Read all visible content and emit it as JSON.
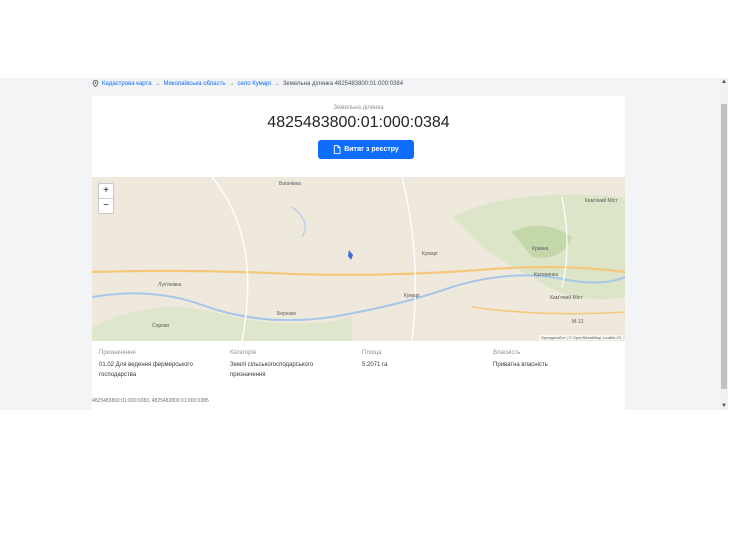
{
  "breadcrumb": {
    "items": [
      "Кадастрова карта",
      "Миколаївська область",
      "село Кумарі"
    ],
    "separator": "→",
    "current": "Земельна ділянка 4825483800:01:000:0384"
  },
  "header": {
    "eyebrow": "Земельна ділянка",
    "parcel_number": "4825483800:01:000:0384",
    "extract_button": "Витяг з реєстру"
  },
  "map": {
    "zoom_in": "+",
    "zoom_out": "−",
    "attribution": "Openдатабот | © OpenStreetMap, Leaflet.JS",
    "places": {
      "bahachivka": "Багачівка",
      "kamianyi_mist_1": "Кам'яний Міст",
      "kumari_1": "Кумарі",
      "krynka": "Кринка",
      "katerynka": "Катеринка",
      "kumari_2": "Кумарі",
      "kamianyi_mist_2": "Кам'яний Міст",
      "lukashivka": "Лук'янівка",
      "berezky": "Березки",
      "sorochi": "Сороки",
      "m13": "M-13"
    }
  },
  "info": [
    {
      "label": "Призначення",
      "value": "01.02 Для ведення фермерського господарства"
    },
    {
      "label": "Категорія",
      "value": "Землі сільськогосподарського призначення"
    },
    {
      "label": "Площа",
      "value": "5.2071 га"
    },
    {
      "label": "Власність",
      "value": "Приватна власність"
    }
  ],
  "footer": {
    "neighbours": "4825483800:01:000:0383, 4825483800:01:000:0385"
  },
  "colors": {
    "accent": "#0d6efd",
    "parcel": "#3b6fd4",
    "road": "#f4c77b",
    "river": "#a8c7e8",
    "forest": "#c9dbad"
  }
}
